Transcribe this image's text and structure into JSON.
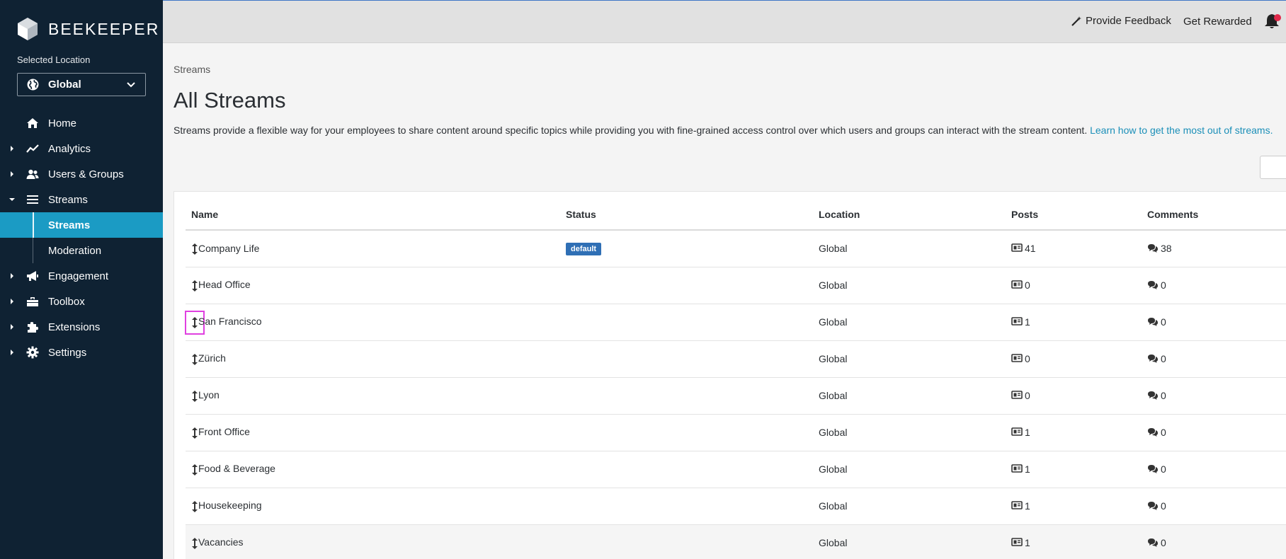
{
  "brand": {
    "name": "BEEKEEPER"
  },
  "sidebar": {
    "location_label": "Selected Location",
    "location_value": "Global",
    "items": [
      {
        "label": "Home",
        "icon": "home-icon"
      },
      {
        "label": "Analytics",
        "icon": "analytics-icon"
      },
      {
        "label": "Users & Groups",
        "icon": "users-icon"
      },
      {
        "label": "Streams",
        "icon": "streams-icon"
      },
      {
        "label": "Engagement",
        "icon": "megaphone-icon"
      },
      {
        "label": "Toolbox",
        "icon": "toolbox-icon"
      },
      {
        "label": "Extensions",
        "icon": "puzzle-icon"
      },
      {
        "label": "Settings",
        "icon": "gear-icon"
      }
    ],
    "sub_items": [
      {
        "label": "Streams",
        "active": true
      },
      {
        "label": "Moderation",
        "active": false
      }
    ]
  },
  "topbar": {
    "feedback": "Provide Feedback",
    "rewarded": "Get Rewarded"
  },
  "main": {
    "breadcrumb": "Streams",
    "title": "All Streams",
    "intro": "Streams provide a flexible way for your employees to share content around specific topics while providing you with fine-grained access control over which users and groups can interact with the stream content.",
    "intro_link": "Learn how to get the most out of streams."
  },
  "table": {
    "headers": [
      "Name",
      "Status",
      "Location",
      "Posts",
      "Comments"
    ],
    "rows": [
      {
        "name": "Company Life",
        "status": "default",
        "location": "Global",
        "posts": "41",
        "comments": "38"
      },
      {
        "name": "Head Office",
        "status": "",
        "location": "Global",
        "posts": "0",
        "comments": "0"
      },
      {
        "name": "San Francisco",
        "status": "",
        "location": "Global",
        "posts": "1",
        "comments": "0"
      },
      {
        "name": "Zürich",
        "status": "",
        "location": "Global",
        "posts": "0",
        "comments": "0"
      },
      {
        "name": "Lyon",
        "status": "",
        "location": "Global",
        "posts": "0",
        "comments": "0"
      },
      {
        "name": "Front Office",
        "status": "",
        "location": "Global",
        "posts": "1",
        "comments": "0"
      },
      {
        "name": "Food & Beverage",
        "status": "",
        "location": "Global",
        "posts": "1",
        "comments": "0"
      },
      {
        "name": "Housekeeping",
        "status": "",
        "location": "Global",
        "posts": "1",
        "comments": "0"
      },
      {
        "name": "Vacancies",
        "status": "",
        "location": "Global",
        "posts": "1",
        "comments": "0"
      }
    ]
  },
  "colors": {
    "sidebar_bg": "#0f2233",
    "accent": "#1b9bc4",
    "badge": "#2f6fb5",
    "notification": "#e0294a",
    "link": "#1b8fb8"
  }
}
